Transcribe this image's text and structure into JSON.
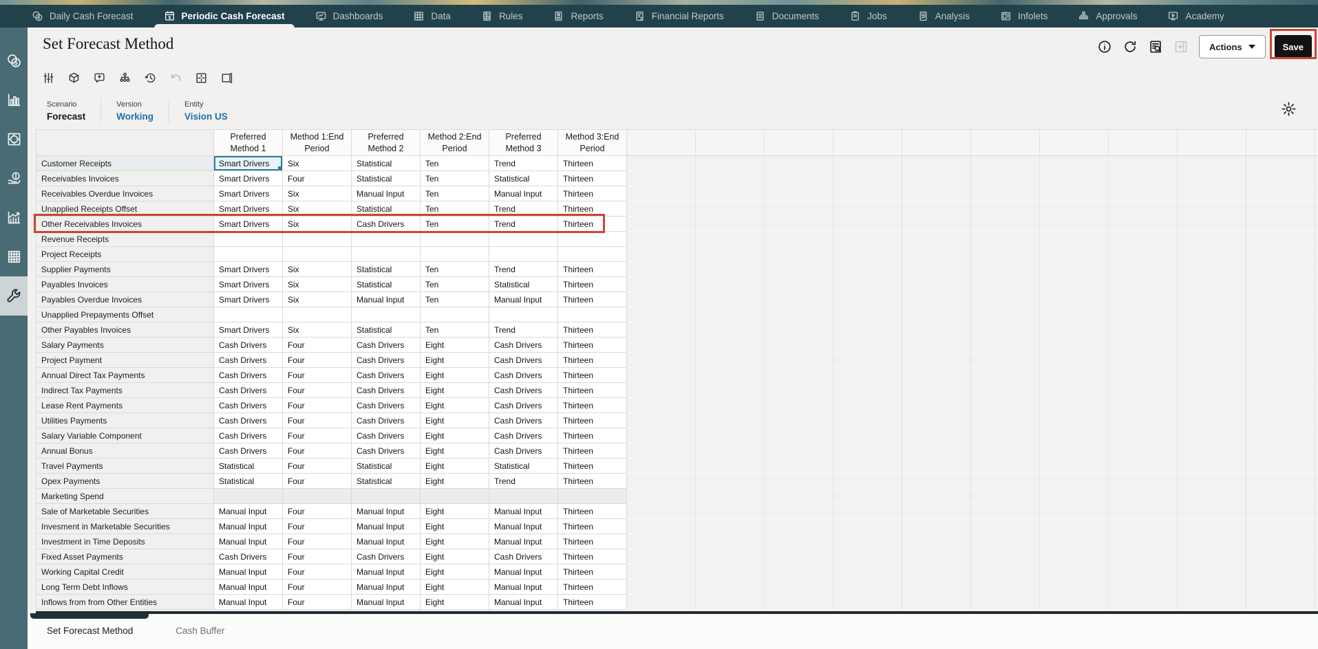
{
  "page": {
    "title": "Set Forecast Method"
  },
  "colors": {
    "nav_background": "#22424b",
    "sidebar_background": "#486b75",
    "pov_link_blue": "#1e6fae",
    "annotation_red": "#c74634",
    "save_button_background": "#121212",
    "selected_cell_border": "#2f7d9e"
  },
  "topnav": {
    "tabs": [
      {
        "label": "Daily Cash Forecast",
        "icon": "coin-dollar",
        "active": false
      },
      {
        "label": "Periodic Cash Forecast",
        "icon": "calendar-dollar",
        "active": true
      },
      {
        "label": "Dashboards",
        "icon": "monitor-chart",
        "active": false
      },
      {
        "label": "Data",
        "icon": "data-grid",
        "active": false
      },
      {
        "label": "Rules",
        "icon": "rules-calc",
        "active": false
      },
      {
        "label": "Reports",
        "icon": "reports-doc",
        "active": false
      },
      {
        "label": "Financial Reports",
        "icon": "financial-doc",
        "active": false
      },
      {
        "label": "Documents",
        "icon": "documents-doc",
        "active": false
      },
      {
        "label": "Jobs",
        "icon": "jobs-clipboard",
        "active": false
      },
      {
        "label": "Analysis",
        "icon": "analysis-doc",
        "active": false
      },
      {
        "label": "Infolets",
        "icon": "infolets-window",
        "active": false
      },
      {
        "label": "Approvals",
        "icon": "approvals-org",
        "active": false
      },
      {
        "label": "Academy",
        "icon": "academy-screen",
        "active": false
      }
    ]
  },
  "sidebar": {
    "items": [
      {
        "name": "cash-forecast",
        "icon": "coin-dollar",
        "selected": false
      },
      {
        "name": "reports",
        "icon": "bar-chart",
        "selected": false
      },
      {
        "name": "dashboards",
        "icon": "target-square",
        "selected": false
      },
      {
        "name": "funding",
        "icon": "funding-hand",
        "selected": false
      },
      {
        "name": "analysis",
        "icon": "trend-chart",
        "selected": false
      },
      {
        "name": "data-grids",
        "icon": "table-grid",
        "selected": false
      },
      {
        "name": "configure",
        "icon": "wrench",
        "selected": true
      }
    ]
  },
  "header_actions": {
    "icons": [
      {
        "name": "info",
        "icon": "info",
        "disabled": false
      },
      {
        "name": "refresh",
        "icon": "refresh",
        "disabled": false
      },
      {
        "name": "saved-selections",
        "icon": "query-list",
        "disabled": false
      },
      {
        "name": "expand-panel",
        "icon": "collapse-panel",
        "disabled": true
      }
    ],
    "actions_label": "Actions",
    "save_label": "Save"
  },
  "toolbar": {
    "buttons": [
      {
        "name": "adjust",
        "icon": "adjust-sliders",
        "disabled": false
      },
      {
        "name": "dimensions",
        "icon": "cube",
        "disabled": false
      },
      {
        "name": "comments",
        "icon": "comment-add",
        "disabled": false
      },
      {
        "name": "hierarchy",
        "icon": "hierarchy",
        "disabled": false
      },
      {
        "name": "history",
        "icon": "history",
        "disabled": false
      },
      {
        "name": "undo",
        "icon": "undo",
        "disabled": true
      },
      {
        "name": "grid-layout",
        "icon": "grid-expand",
        "disabled": false
      },
      {
        "name": "freeze",
        "icon": "freeze-pane",
        "disabled": false
      }
    ]
  },
  "pov": {
    "members": [
      {
        "dimension": "Scenario",
        "member": "Forecast",
        "link": false
      },
      {
        "dimension": "Version",
        "member": "Working",
        "link": true
      },
      {
        "dimension": "Entity",
        "member": "Vision US",
        "link": true
      }
    ]
  },
  "grid": {
    "columns": [
      "Preferred Method 1",
      "Method 1:End Period",
      "Preferred Method 2",
      "Method 2:End Period",
      "Preferred Method 3",
      "Method 3:End Period"
    ],
    "selected_cell": {
      "row": 0,
      "col": 0
    },
    "highlighted_row": 4,
    "rows": [
      {
        "label": "Customer Receipts",
        "gray": false,
        "values": [
          "Smart Drivers",
          "Six",
          "Statistical",
          "Ten",
          "Trend",
          "Thirteen"
        ]
      },
      {
        "label": "Receivables Invoices",
        "gray": false,
        "values": [
          "Smart Drivers",
          "Four",
          "Statistical",
          "Ten",
          "Statistical",
          "Thirteen"
        ]
      },
      {
        "label": "Receivables Overdue Invoices",
        "gray": false,
        "values": [
          "Smart Drivers",
          "Six",
          "Manual Input",
          "Ten",
          "Manual Input",
          "Thirteen"
        ]
      },
      {
        "label": "Unapplied Receipts Offset",
        "gray": false,
        "values": [
          "Smart Drivers",
          "Six",
          "Statistical",
          "Ten",
          "Trend",
          "Thirteen"
        ]
      },
      {
        "label": "Other Receivables Invoices",
        "gray": false,
        "values": [
          "Smart Drivers",
          "Six",
          "Cash Drivers",
          "Ten",
          "Trend",
          "Thirteen"
        ]
      },
      {
        "label": "Revenue Receipts",
        "gray": false,
        "values": [
          "",
          "",
          "",
          "",
          "",
          ""
        ]
      },
      {
        "label": "Project Receipts",
        "gray": false,
        "values": [
          "",
          "",
          "",
          "",
          "",
          ""
        ]
      },
      {
        "label": "Supplier Payments",
        "gray": false,
        "values": [
          "Smart Drivers",
          "Six",
          "Statistical",
          "Ten",
          "Trend",
          "Thirteen"
        ]
      },
      {
        "label": "Payables Invoices",
        "gray": false,
        "values": [
          "Smart Drivers",
          "Six",
          "Statistical",
          "Ten",
          "Statistical",
          "Thirteen"
        ]
      },
      {
        "label": "Payables Overdue Invoices",
        "gray": false,
        "values": [
          "Smart Drivers",
          "Six",
          "Manual Input",
          "Ten",
          "Manual Input",
          "Thirteen"
        ]
      },
      {
        "label": "Unapplied Prepayments Offset",
        "gray": false,
        "values": [
          "",
          "",
          "",
          "",
          "",
          ""
        ]
      },
      {
        "label": "Other Payables Invoices",
        "gray": false,
        "values": [
          "Smart Drivers",
          "Six",
          "Statistical",
          "Ten",
          "Trend",
          "Thirteen"
        ]
      },
      {
        "label": "Salary Payments",
        "gray": false,
        "values": [
          "Cash Drivers",
          "Four",
          "Cash Drivers",
          "Eight",
          "Cash Drivers",
          "Thirteen"
        ]
      },
      {
        "label": "Project Payment",
        "gray": false,
        "values": [
          "Cash Drivers",
          "Four",
          "Cash Drivers",
          "Eight",
          "Cash Drivers",
          "Thirteen"
        ]
      },
      {
        "label": "Annual Direct Tax Payments",
        "gray": false,
        "values": [
          "Cash Drivers",
          "Four",
          "Cash Drivers",
          "Eight",
          "Cash Drivers",
          "Thirteen"
        ]
      },
      {
        "label": "Indirect Tax Payments",
        "gray": false,
        "values": [
          "Cash Drivers",
          "Four",
          "Cash Drivers",
          "Eight",
          "Cash Drivers",
          "Thirteen"
        ]
      },
      {
        "label": "Lease Rent Payments",
        "gray": false,
        "values": [
          "Cash Drivers",
          "Four",
          "Cash Drivers",
          "Eight",
          "Cash Drivers",
          "Thirteen"
        ]
      },
      {
        "label": "Utilities Payments",
        "gray": false,
        "values": [
          "Cash Drivers",
          "Four",
          "Cash Drivers",
          "Eight",
          "Cash Drivers",
          "Thirteen"
        ]
      },
      {
        "label": "Salary Variable Component",
        "gray": false,
        "values": [
          "Cash Drivers",
          "Four",
          "Cash Drivers",
          "Eight",
          "Cash Drivers",
          "Thirteen"
        ]
      },
      {
        "label": "Annual Bonus",
        "gray": false,
        "values": [
          "Cash Drivers",
          "Four",
          "Cash Drivers",
          "Eight",
          "Cash Drivers",
          "Thirteen"
        ]
      },
      {
        "label": "Travel Payments",
        "gray": false,
        "values": [
          "Statistical",
          "Four",
          "Statistical",
          "Eight",
          "Statistical",
          "Thirteen"
        ]
      },
      {
        "label": "Opex Payments",
        "gray": false,
        "values": [
          "Statistical",
          "Four",
          "Statistical",
          "Eight",
          "Trend",
          "Thirteen"
        ]
      },
      {
        "label": "Marketing Spend",
        "gray": true,
        "values": [
          "",
          "",
          "",
          "",
          "",
          ""
        ]
      },
      {
        "label": "Sale of Marketable Securities",
        "gray": false,
        "values": [
          "Manual Input",
          "Four",
          "Manual Input",
          "Eight",
          "Manual Input",
          "Thirteen"
        ]
      },
      {
        "label": "Invesment in Marketable Securities",
        "gray": false,
        "values": [
          "Manual Input",
          "Four",
          "Manual Input",
          "Eight",
          "Manual Input",
          "Thirteen"
        ]
      },
      {
        "label": "Investment in Time Deposits",
        "gray": false,
        "values": [
          "Manual Input",
          "Four",
          "Manual Input",
          "Eight",
          "Manual Input",
          "Thirteen"
        ]
      },
      {
        "label": "Fixed Asset Payments",
        "gray": false,
        "values": [
          "Cash Drivers",
          "Four",
          "Cash Drivers",
          "Eight",
          "Cash Drivers",
          "Thirteen"
        ]
      },
      {
        "label": "Working Capital Credit",
        "gray": false,
        "values": [
          "Manual Input",
          "Four",
          "Manual Input",
          "Eight",
          "Manual Input",
          "Thirteen"
        ]
      },
      {
        "label": "Long Term Debt Inflows",
        "gray": false,
        "values": [
          "Manual Input",
          "Four",
          "Manual Input",
          "Eight",
          "Manual Input",
          "Thirteen"
        ]
      },
      {
        "label": "Inflows from from Other Entities",
        "gray": false,
        "values": [
          "Manual Input",
          "Four",
          "Manual Input",
          "Eight",
          "Manual Input",
          "Thirteen"
        ]
      }
    ]
  },
  "bottom_tabs": {
    "tabs": [
      {
        "label": "Set Forecast Method",
        "active": true
      },
      {
        "label": "Cash Buffer",
        "active": false
      }
    ]
  }
}
